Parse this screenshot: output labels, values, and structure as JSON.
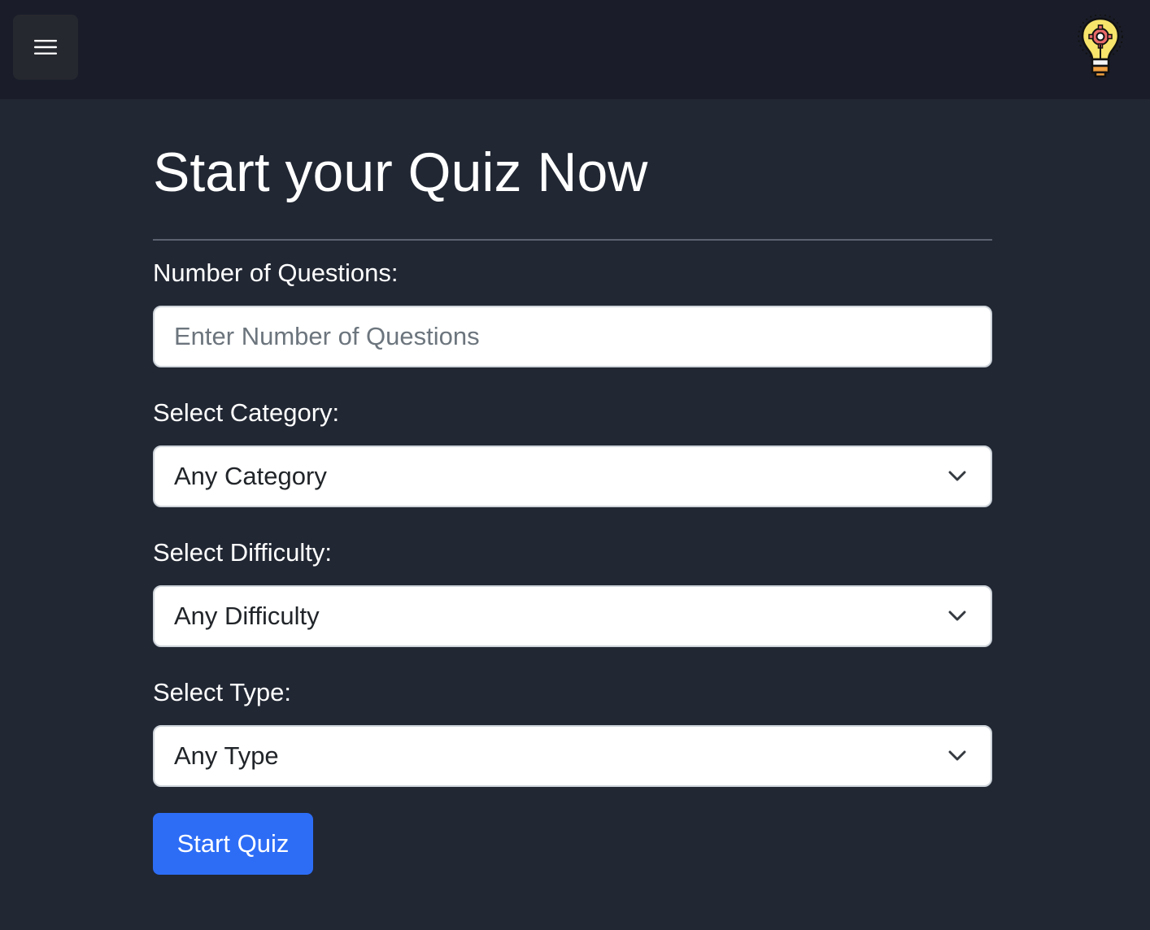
{
  "header": {
    "menu_icon": "hamburger-menu-icon",
    "logo_icon": "lightbulb-gear-icon"
  },
  "form": {
    "title": "Start your Quiz Now",
    "questions": {
      "label": "Number of Questions:",
      "placeholder": "Enter Number of Questions",
      "value": ""
    },
    "category": {
      "label": "Select Category:",
      "selected": "Any Category"
    },
    "difficulty": {
      "label": "Select Difficulty:",
      "selected": "Any Difficulty"
    },
    "type": {
      "label": "Select Type:",
      "selected": "Any Type"
    },
    "submit_label": "Start Quiz"
  },
  "colors": {
    "page_background": "#212733",
    "header_background": "#1a1d29",
    "primary_button": "#2d6df6",
    "logo_bulb": "#f7e46b",
    "logo_gear": "#e86a6a",
    "logo_base": "#f0a040"
  }
}
